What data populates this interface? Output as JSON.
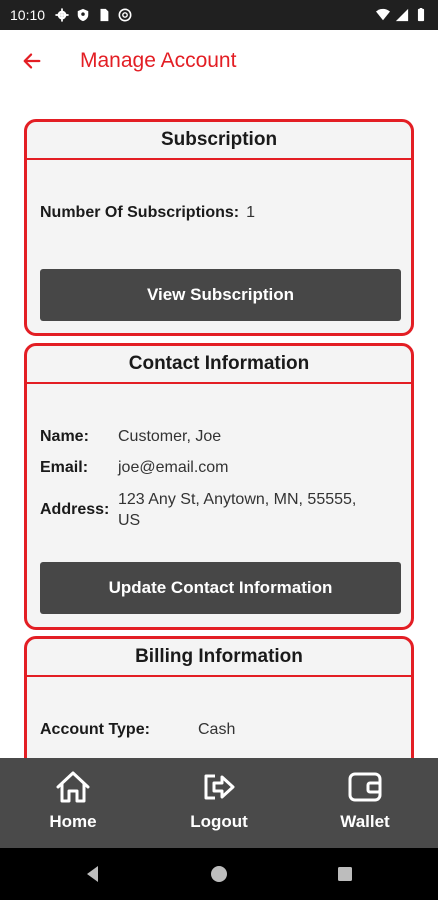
{
  "status_bar": {
    "time": "10:10",
    "icons_left": [
      "gear-icon",
      "shield-icon",
      "sim-card-icon",
      "at-sign-icon"
    ],
    "icons_right": [
      "wifi-icon",
      "signal-icon",
      "battery-icon"
    ]
  },
  "header": {
    "title": "Manage Account",
    "back_icon": "arrow-left-icon"
  },
  "subscription_card": {
    "title": "Subscription",
    "count_label": "Number Of Subscriptions:",
    "count_value": "1",
    "button_label": "View Subscription"
  },
  "contact_card": {
    "title": "Contact Information",
    "name_label": "Name:",
    "name_value": "Customer, Joe",
    "email_label": "Email:",
    "email_value": "joe@email.com",
    "address_label": "Address:",
    "address_line1": "123 Any St, Anytown, MN, 55555,",
    "address_line2": "US",
    "button_label": "Update Contact Information"
  },
  "billing_card": {
    "title": "Billing Information",
    "account_type_label": "Account Type:",
    "account_type_value": "Cash"
  },
  "bottom_nav": {
    "items": [
      {
        "label": "Home",
        "icon": "home-icon"
      },
      {
        "label": "Logout",
        "icon": "logout-icon"
      },
      {
        "label": "Wallet",
        "icon": "wallet-icon"
      }
    ]
  },
  "system_nav": {
    "icons": [
      "back-triangle-icon",
      "home-circle-icon",
      "recents-square-icon"
    ]
  },
  "colors": {
    "accent": "#e31e24",
    "button_bg": "#474747",
    "nav_bg": "#4a4a4a",
    "card_bg": "#f4f4f4"
  }
}
